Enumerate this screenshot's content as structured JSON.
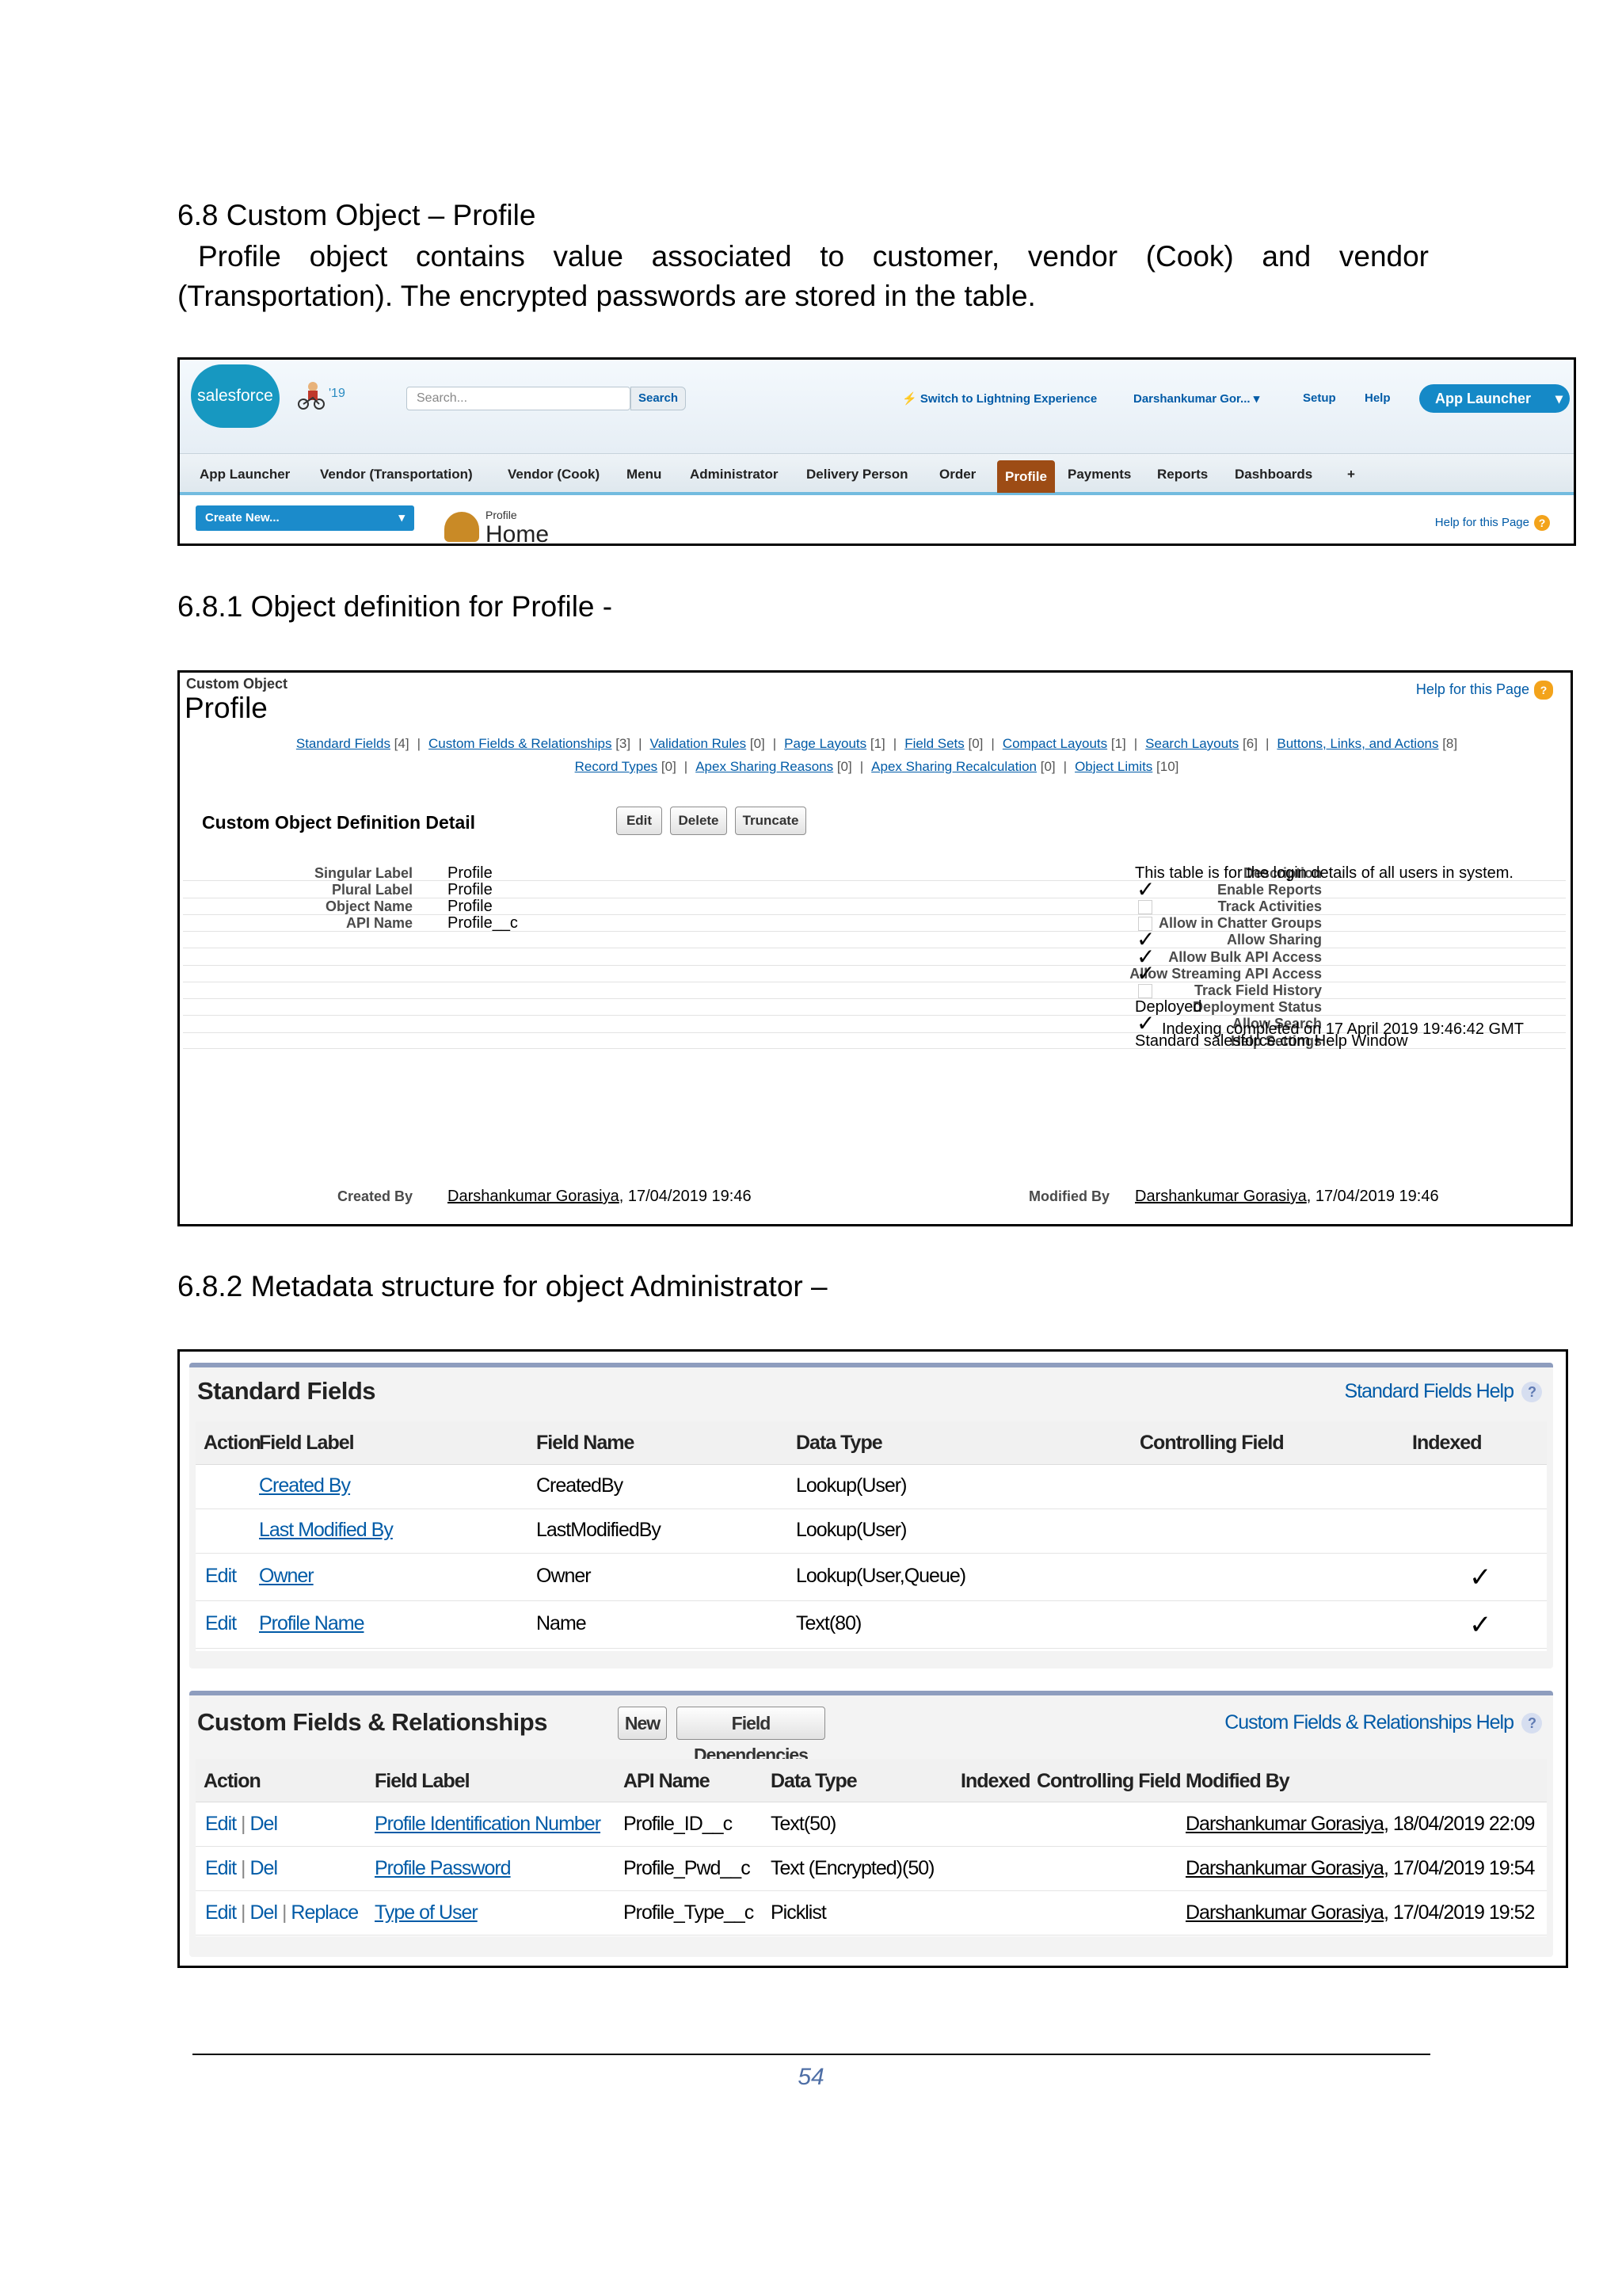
{
  "section_68": {
    "heading": "6.8 Custom Object – Profile",
    "para_line1": "Profile object contains value associated to customer, vendor (Cook) and vendor",
    "para_line2": "(Transportation). The encrypted passwords are stored in the table."
  },
  "header_shot": {
    "logo": "salesforce",
    "year_badge": "'19",
    "search_placeholder": "Search...",
    "search_button": "Search",
    "switch_lightning": "Switch to Lightning Experience",
    "user_menu": "Darshankumar Gor...",
    "setup": "Setup",
    "help": "Help",
    "app_launcher_button": "App Launcher",
    "tabs": [
      "App Launcher",
      "Vendor (Transportation)",
      "Vendor (Cook)",
      "Menu",
      "Administrator",
      "Delivery Person",
      "Order",
      "Profile",
      "Payments",
      "Reports",
      "Dashboards",
      "+"
    ],
    "active_tab": "Profile",
    "create_new": "Create New...",
    "page_type": "Profile",
    "page_title": "Home",
    "help_page": "Help for this Page"
  },
  "section_681": {
    "heading": "6.8.1 Object definition for Profile -"
  },
  "definition_shot": {
    "type_label": "Custom Object",
    "title": "Profile",
    "help_page": "Help for this Page",
    "links_row1": [
      "Standard Fields [4]",
      "Custom Fields & Relationships [3]",
      "Validation Rules [0]",
      "Page Layouts [1]",
      "Field Sets [0]",
      "Compact Layouts [1]",
      "Search Layouts [6]",
      "Buttons, Links, and Actions [8]"
    ],
    "links_row2": [
      "Record Types [0]",
      "Apex Sharing Reasons [0]",
      "Apex Sharing Recalculation [0]",
      "Object Limits [10]"
    ],
    "detail_title": "Custom Object Definition Detail",
    "buttons": {
      "edit": "Edit",
      "delete": "Delete",
      "truncate": "Truncate"
    },
    "left_fields": [
      {
        "label": "Singular Label",
        "value": "Profile"
      },
      {
        "label": "Plural Label",
        "value": "Profile"
      },
      {
        "label": "Object Name",
        "value": "Profile"
      },
      {
        "label": "API Name",
        "value": "Profile__c"
      }
    ],
    "right_fields": [
      {
        "label": "Description",
        "value": "This table is for the login details of all users in system.",
        "kind": "text"
      },
      {
        "label": "Enable Reports",
        "value": "",
        "kind": "check"
      },
      {
        "label": "Track Activities",
        "value": "",
        "kind": "empty"
      },
      {
        "label": "Allow in Chatter Groups",
        "value": "",
        "kind": "empty"
      },
      {
        "label": "Allow Sharing",
        "value": "",
        "kind": "check"
      },
      {
        "label": "Allow Bulk API Access",
        "value": "",
        "kind": "check"
      },
      {
        "label": "Allow Streaming API Access",
        "value": "",
        "kind": "check"
      },
      {
        "label": "Track Field History",
        "value": "",
        "kind": "empty"
      },
      {
        "label": "Deployment Status",
        "value": "Deployed",
        "kind": "text"
      },
      {
        "label": "Allow Search",
        "value": "Indexing completed on 17 April 2019 19:46:42 GMT",
        "kind": "checktext"
      },
      {
        "label": "Help Settings",
        "value": "Standard salesforce.com Help Window",
        "kind": "text"
      }
    ],
    "created_by_label": "Created By",
    "created_by_user": "Darshankumar Gorasiya",
    "created_by_date": ", 17/04/2019 19:46",
    "modified_by_label": "Modified By",
    "modified_by_user": "Darshankumar Gorasiya",
    "modified_by_date": ", 17/04/2019 19:46"
  },
  "section_682": {
    "heading": "6.8.2 Metadata structure for object Administrator –"
  },
  "metadata_shot": {
    "standard": {
      "title": "Standard Fields",
      "help": "Standard Fields Help",
      "columns": [
        "Action",
        "Field Label",
        "Field Name",
        "Data Type",
        "Controlling Field",
        "Indexed"
      ],
      "rows": [
        {
          "action": "",
          "label": "Created By",
          "name": "CreatedBy",
          "type": "Lookup(User)",
          "controlling": "",
          "indexed": false
        },
        {
          "action": "",
          "label": "Last Modified By",
          "name": "LastModifiedBy",
          "type": "Lookup(User)",
          "controlling": "",
          "indexed": false
        },
        {
          "action": "Edit",
          "label": "Owner",
          "name": "Owner",
          "type": "Lookup(User,Queue)",
          "controlling": "",
          "indexed": true
        },
        {
          "action": "Edit",
          "label": "Profile Name",
          "name": "Name",
          "type": "Text(80)",
          "controlling": "",
          "indexed": true
        }
      ]
    },
    "custom": {
      "title": "Custom Fields & Relationships",
      "new_button": "New",
      "deps_button": "Field Dependencies",
      "help": "Custom Fields & Relationships Help",
      "columns": [
        "Action",
        "Field Label",
        "API Name",
        "Data Type",
        "Indexed",
        "Controlling Field",
        "Modified By"
      ],
      "rows": [
        {
          "actions": [
            "Edit",
            "Del"
          ],
          "label": "Profile Identification Number",
          "api": "Profile_ID__c",
          "type": "Text(50)",
          "indexed": "",
          "controlling": "",
          "mod_user": "Darshankumar Gorasiya",
          "mod_date": ", 18/04/2019 22:09"
        },
        {
          "actions": [
            "Edit",
            "Del"
          ],
          "label": "Profile Password",
          "api": "Profile_Pwd__c",
          "type": "Text (Encrypted)(50)",
          "indexed": "",
          "controlling": "",
          "mod_user": "Darshankumar Gorasiya",
          "mod_date": ", 17/04/2019 19:54"
        },
        {
          "actions": [
            "Edit",
            "Del",
            "Replace"
          ],
          "label": "Type of User",
          "api": "Profile_Type__c",
          "type": "Picklist",
          "indexed": "",
          "controlling": "",
          "mod_user": "Darshankumar Gorasiya",
          "mod_date": ", 17/04/2019 19:52"
        }
      ]
    }
  },
  "footer": {
    "page_number": "54"
  }
}
